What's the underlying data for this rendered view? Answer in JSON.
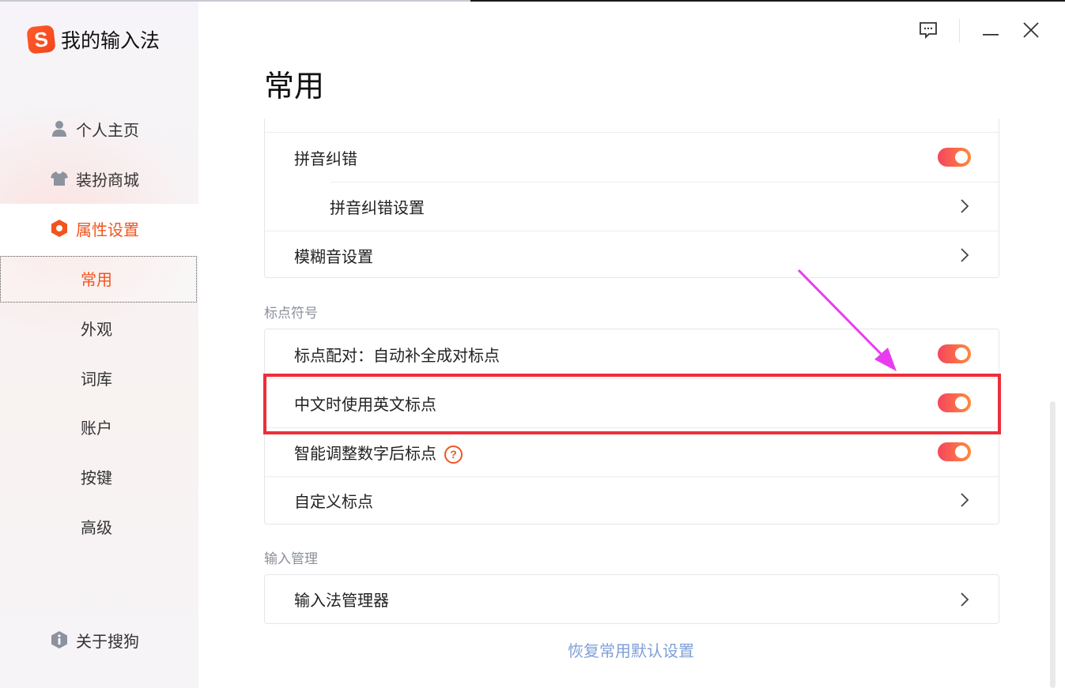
{
  "app": {
    "name": "我的输入法",
    "logo_letter": "S",
    "brand_color": "#f2541e"
  },
  "sidebar": {
    "items": [
      {
        "label": "个人主页",
        "icon": "user-icon"
      },
      {
        "label": "装扮商城",
        "icon": "tshirt-icon"
      },
      {
        "label": "属性设置",
        "icon": "hexagon-settings-icon",
        "active": true
      }
    ],
    "sub_items": [
      {
        "label": "常用",
        "selected": true
      },
      {
        "label": "外观"
      },
      {
        "label": "词库"
      },
      {
        "label": "账户"
      },
      {
        "label": "按键"
      },
      {
        "label": "高级"
      }
    ],
    "about": {
      "label": "关于搜狗",
      "icon": "info-icon"
    }
  },
  "window_controls": [
    "feedback-icon",
    "minimize-icon",
    "close-icon"
  ],
  "page": {
    "title": "常用"
  },
  "sections": {
    "pinyin": {
      "rows": [
        {
          "label": "拼音纠错",
          "type": "toggle",
          "on": true
        },
        {
          "label": "拼音纠错设置",
          "type": "link",
          "indent": true
        },
        {
          "label": "模糊音设置",
          "type": "link"
        }
      ]
    },
    "punctuation": {
      "title": "标点符号",
      "rows": [
        {
          "label": "标点配对：自动补全成对标点",
          "type": "toggle",
          "on": true
        },
        {
          "label": "中文时使用英文标点",
          "type": "toggle",
          "on": true,
          "highlighted": true
        },
        {
          "label": "智能调整数字后标点",
          "type": "toggle",
          "on": true,
          "help": "?"
        },
        {
          "label": "自定义标点",
          "type": "link"
        }
      ]
    },
    "input_management": {
      "title": "输入管理",
      "rows": [
        {
          "label": "输入法管理器",
          "type": "link"
        }
      ]
    }
  },
  "footer": {
    "restore_label": "恢复常用默认设置"
  },
  "colors": {
    "toggle_start": "#f5455e",
    "toggle_end": "#ff8a3b",
    "highlight_box": "#ee2e3a",
    "annotation_arrow": "#e83cf0",
    "link": "#7e9fd8"
  }
}
